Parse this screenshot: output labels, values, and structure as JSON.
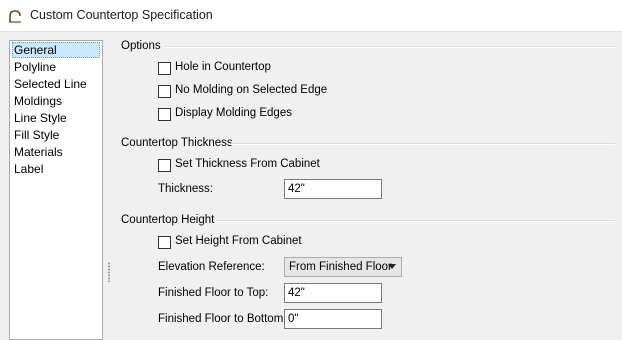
{
  "window": {
    "title": "Custom Countertop Specification"
  },
  "sidebar": {
    "items": [
      {
        "label": "General",
        "selected": true
      },
      {
        "label": "Polyline"
      },
      {
        "label": "Selected Line"
      },
      {
        "label": "Moldings"
      },
      {
        "label": "Line Style"
      },
      {
        "label": "Fill Style"
      },
      {
        "label": "Materials"
      },
      {
        "label": "Label"
      }
    ]
  },
  "options": {
    "heading": "Options",
    "hole_in_countertop": "Hole in Countertop",
    "no_molding_selected_edge": "No Molding on Selected Edge",
    "display_molding_edges": "Display Molding Edges"
  },
  "thickness": {
    "heading": "Countertop Thickness",
    "set_from_cabinet": "Set Thickness From Cabinet",
    "label": "Thickness:",
    "value": "42\""
  },
  "height": {
    "heading": "Countertop Height",
    "set_from_cabinet": "Set Height From Cabinet",
    "elevation_label": "Elevation Reference:",
    "elevation_value": "From Finished Floor",
    "floor_to_top_label": "Finished Floor to Top:",
    "floor_to_top_value": "42\"",
    "floor_to_bottom_label": "Finished Floor to Bottom:",
    "floor_to_bottom_value": "0\""
  }
}
